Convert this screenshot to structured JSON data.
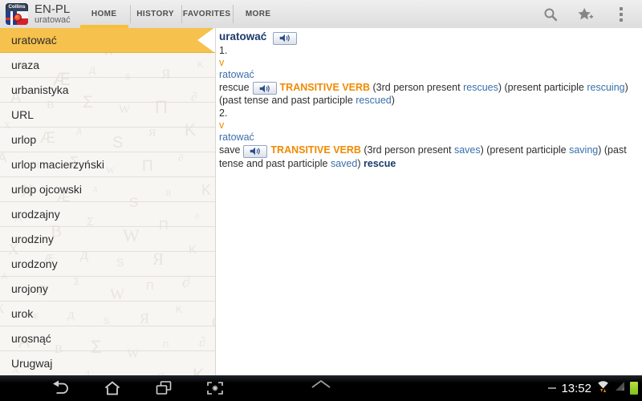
{
  "app_bar": {
    "logo_text": "Collins",
    "title": "EN-PL",
    "subtitle": "uratować",
    "tabs": [
      {
        "label": "HOME",
        "active": true
      },
      {
        "label": "HISTORY",
        "active": false
      },
      {
        "label": "FAVORITES",
        "active": false
      },
      {
        "label": "MORE",
        "active": false
      }
    ],
    "action_icons": [
      "search-icon",
      "add-favorite-star-icon",
      "overflow-menu-icon"
    ]
  },
  "sidebar": {
    "selected_index": 0,
    "items": [
      "uratować",
      "uraza",
      "urbanistyka",
      "URL",
      "urlop",
      "urlop macierzyński",
      "urlop ojcowski",
      "urodzajny",
      "urodziny",
      "urodzony",
      "urojony",
      "urok",
      "urosnąć",
      "Urugwaj"
    ]
  },
  "entry": {
    "headword": "uratować",
    "senses": [
      {
        "number": "1.",
        "pos": "v",
        "source_word": "ratować",
        "translation": "rescue",
        "grammar": "TRANSITIVE VERB",
        "forms": [
          {
            "label": "3rd person present",
            "word": "rescues"
          },
          {
            "label": "present participle",
            "word": "rescuing"
          },
          {
            "label": "past tense and past participle",
            "word": "rescued"
          }
        ],
        "cross_reference": ""
      },
      {
        "number": "2.",
        "pos": "v",
        "source_word": "ratować",
        "translation": "save",
        "grammar": "TRANSITIVE VERB",
        "forms": [
          {
            "label": "3rd person present",
            "word": "saves"
          },
          {
            "label": "present participle",
            "word": "saving"
          },
          {
            "label": "past tense and past participle",
            "word": "saved"
          }
        ],
        "cross_reference": "rescue"
      }
    ]
  },
  "system_bar": {
    "time": "13:52",
    "nav_icons": [
      "back-icon",
      "home-icon",
      "recent-apps-icon",
      "screenshot-icon"
    ],
    "status_icons": [
      "notification-dash-icon",
      "wifi-icon",
      "signal-icon",
      "battery-icon"
    ],
    "quick_access_icon": "chevron-up-icon"
  },
  "colors": {
    "highlight_yellow": "#f6c14d",
    "tab_underline": "#f8bf3c",
    "accent_orange": "#f08a00",
    "headword_navy": "#1a3a6b",
    "link_blue": "#3a6fad",
    "battery_green": "#8fc92e"
  }
}
